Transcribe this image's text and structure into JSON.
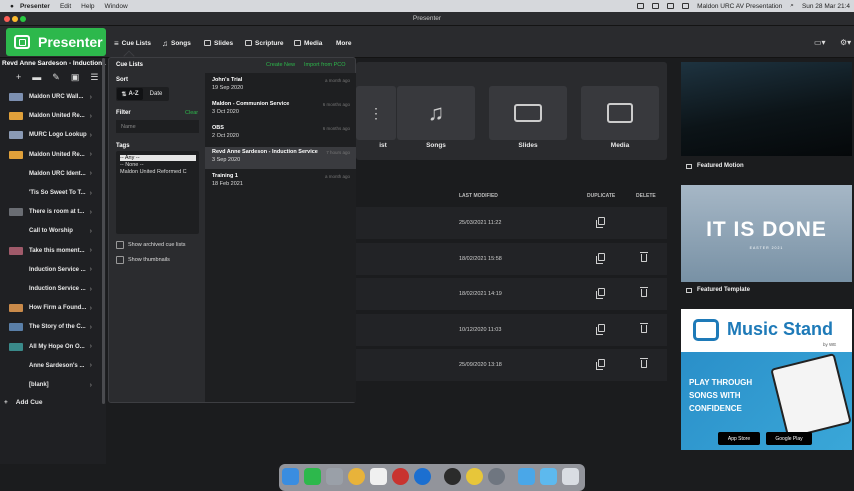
{
  "menubar": {
    "app": "Presenter",
    "items": [
      "Edit",
      "Help",
      "Window"
    ],
    "right_text": "Maldon URC AV Presentation",
    "clock": "Sun 28 Mar 21:4"
  },
  "window": {
    "title": "Presenter"
  },
  "logo": {
    "text": "Presenter"
  },
  "nav": {
    "cue_lists": "Cue Lists",
    "songs": "Songs",
    "slides": "Slides",
    "scripture": "Scripture",
    "media": "Media",
    "more": "More"
  },
  "sidebar": {
    "title": "Revd Anne Sardeson - Induction...",
    "items": [
      {
        "label": "Maldon URC Wall...",
        "color": "#7c8fb0"
      },
      {
        "label": "Maldon United Re...",
        "color": "#e0a03a"
      },
      {
        "label": "MURC Logo Lookup",
        "color": "#8a9ab5"
      },
      {
        "label": "Maldon United Re...",
        "color": "#e0a03a"
      },
      {
        "label": "Maldon URC Ident...",
        "color": ""
      },
      {
        "label": "'Tis So Sweet To T...",
        "color": ""
      },
      {
        "label": "There is room at t...",
        "color": "#6a6d73"
      },
      {
        "label": "Call to Worship",
        "color": ""
      },
      {
        "label": "Take this moment...",
        "color": "#a05a6a"
      },
      {
        "label": "Induction Service ...",
        "color": ""
      },
      {
        "label": "Induction Service ...",
        "color": ""
      },
      {
        "label": "How Firm a Found...",
        "color": "#c98a4a"
      },
      {
        "label": "The Story of the C...",
        "color": "#5a7fa8"
      },
      {
        "label": "All My Hope On O...",
        "color": "#3a8a8a"
      },
      {
        "label": "Anne Sardeson's ...",
        "color": ""
      },
      {
        "label": "[blank]",
        "color": ""
      }
    ],
    "add_cue": "Add Cue"
  },
  "popover": {
    "title": "Cue Lists",
    "create_new": "Create New",
    "import": "Import from PCO",
    "sort_label": "Sort",
    "sort_az": "A-Z",
    "sort_date": "Date",
    "filter_label": "Filter",
    "filter_clear": "Clear",
    "filter_placeholder": "Name",
    "tags_label": "Tags",
    "tags": [
      "-- Any --",
      "-- None --",
      "Maldon United Reformed C"
    ],
    "show_archived": "Show archived cue lists",
    "show_thumbnails": "Show thumbnails",
    "cue_lists": [
      {
        "name": "John's Trial",
        "date": "19 Sep 2020",
        "ago": "a month ago"
      },
      {
        "name": "Maldon - Communion Service",
        "date": "3 Oct 2020",
        "ago": "6 months ago"
      },
      {
        "name": "OBS",
        "date": "2 Oct 2020",
        "ago": "6 months ago"
      },
      {
        "name": "Revd Anne Sardeson - Induction Service",
        "date": "3 Sep 2020",
        "ago": "7 hours ago"
      },
      {
        "name": "Training 1",
        "date": "18 Feb 2021",
        "ago": "a month ago"
      }
    ]
  },
  "main": {
    "cards": [
      "Playlist",
      "Songs",
      "Slides",
      "Media"
    ],
    "col_last_modified": "LAST MODIFIED",
    "col_duplicate": "DUPLICATE",
    "col_delete": "DELETE",
    "rows": [
      "25/03/2021 11:22",
      "18/02/2021 15:58",
      "18/02/2021 14:19",
      "10/12/2020 11:03",
      "25/09/2020 13:18"
    ]
  },
  "right": {
    "featured_motion": "Featured Motion",
    "featured_template": "Featured Template",
    "template_banner": "IT IS DONE",
    "template_sub": "EASTER 2021",
    "ad_title": "Music Stand",
    "ad_by": "by WE",
    "ad_tagline": "PLAY THROUGH SONGS WITH CONFIDENCE",
    "ad_app_store": "App Store",
    "ad_google_play": "Google Play"
  }
}
